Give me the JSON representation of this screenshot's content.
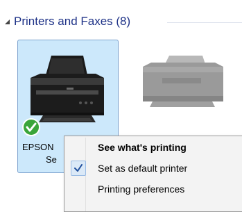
{
  "group": {
    "title": "Printers and Faxes (8)",
    "collapse_icon": "triangle-collapse-icon"
  },
  "printers": [
    {
      "name": "EPSON",
      "name_continuation": "Se",
      "is_default": true,
      "selected": true,
      "icon": "printer-icon",
      "badge_icon": "default-check-icon"
    },
    {
      "name": "",
      "icon": "printer-icon",
      "dimmed": true
    }
  ],
  "context_menu": {
    "items": [
      {
        "label": "See what's printing",
        "bold": true,
        "checked": false
      },
      {
        "label": "Set as default printer",
        "bold": false,
        "checked": true,
        "check_icon": "checkmark-icon"
      },
      {
        "label": "Printing preferences",
        "bold": false,
        "checked": false
      }
    ]
  },
  "colors": {
    "selection_bg": "#cce8fb",
    "selection_border": "#7da2ce",
    "group_title": "#1e3287",
    "menu_bg": "#f3f3f3",
    "check_green": "#3aa53a"
  }
}
